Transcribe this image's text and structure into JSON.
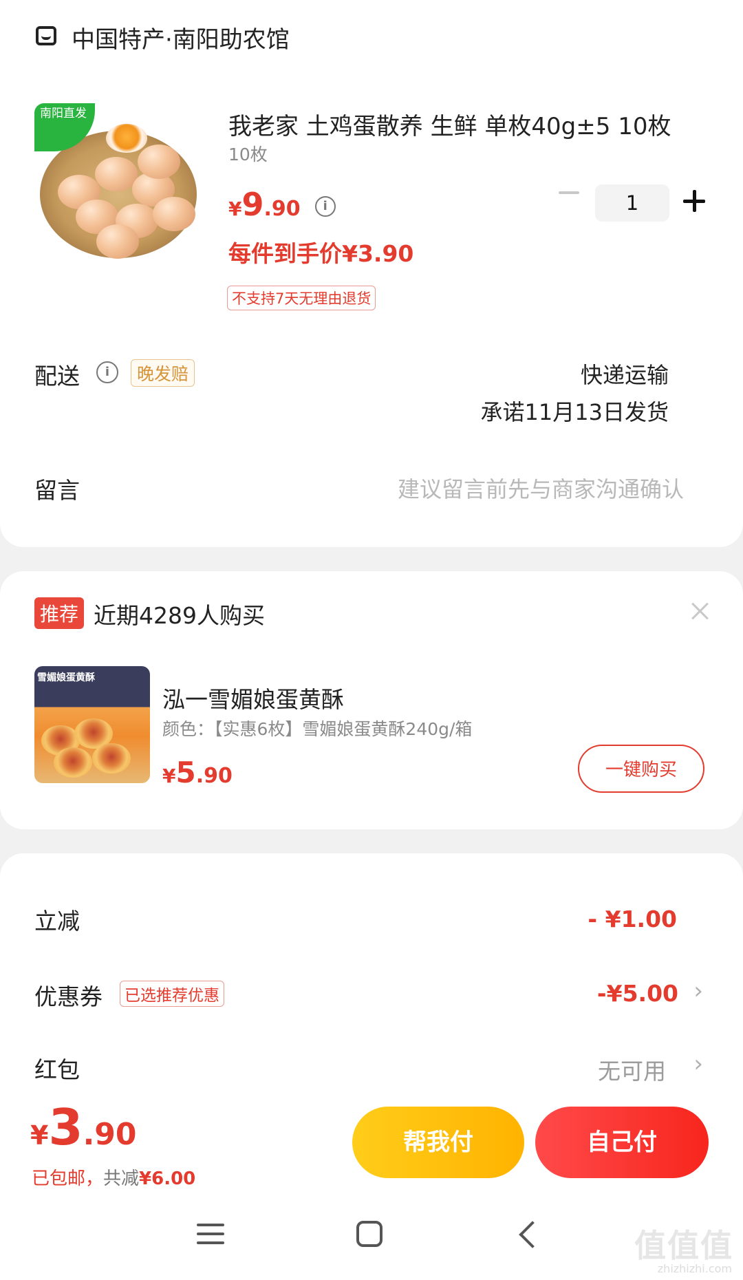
{
  "store": {
    "name": "中国特产·南阳助农馆",
    "icon": "store-icon"
  },
  "product": {
    "corner_tag": "南阳直发",
    "title": "我老家 土鸡蛋散养 生鲜 单枚40g±5 10枚",
    "spec": "10枚",
    "price_currency": "¥",
    "price_int": "9",
    "price_dec": ".90",
    "deal_price": "每件到手价¥3.90",
    "return_policy": "不支持7天无理由退货",
    "quantity": "1"
  },
  "shipping": {
    "label": "配送",
    "late_tag": "晚发赔",
    "method": "快递运输",
    "promise": "承诺11月13日发货"
  },
  "memo": {
    "label": "留言",
    "placeholder": "建议留言前先与商家沟通确认"
  },
  "recommend": {
    "badge": "推荐",
    "title": "近期4289人购买",
    "image_title": "雪媚娘蛋黄酥",
    "name": "泓一雪媚娘蛋黄酥",
    "spec": "颜色：【实惠6枚】雪媚娘蛋黄酥240g/箱",
    "price_currency": "¥",
    "price_int": "5",
    "price_dec": ".90",
    "buy_label": "一键购买"
  },
  "summary": {
    "discount_label": "立减",
    "discount_value": "- ¥1.00",
    "coupon_label": "优惠券",
    "coupon_tag": "已选推荐优惠",
    "coupon_value": "-¥5.00",
    "redpacket_label": "红包",
    "redpacket_value": "无可用"
  },
  "footer": {
    "total_currency": "¥",
    "total_int": "3",
    "total_dec": ".90",
    "shipping_note": "已包邮，",
    "saved_label": "共减",
    "saved_value": "¥6.00",
    "help_pay_label": "帮我付",
    "self_pay_label": "自己付"
  },
  "watermark": {
    "text": "值值值",
    "url": "zhizhizhi.com"
  },
  "colors": {
    "accent_red": "#e33b2e",
    "pay_yellow": "#ffb300",
    "pay_red": "#f7261d"
  }
}
